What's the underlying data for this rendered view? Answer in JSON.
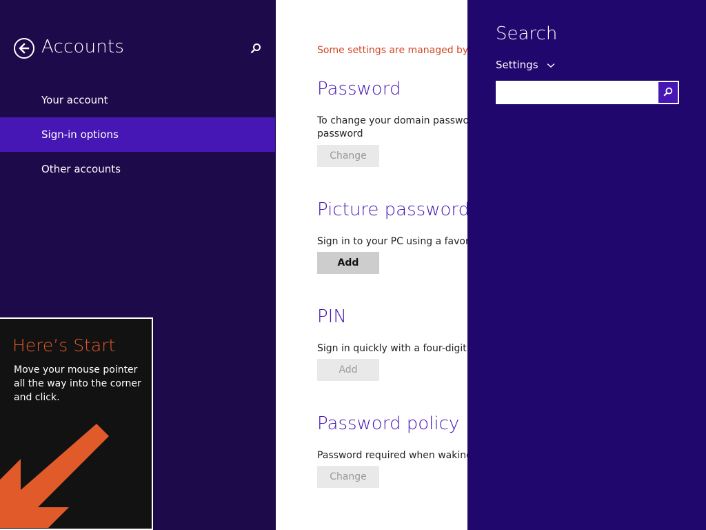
{
  "nav": {
    "title": "Accounts",
    "items": [
      {
        "label": "Your account",
        "selected": false
      },
      {
        "label": "Sign-in options",
        "selected": true
      },
      {
        "label": "Other accounts",
        "selected": false
      }
    ]
  },
  "tip": {
    "title": "Here’s Start",
    "body": "Move your mouse pointer all the way into the corner and click."
  },
  "content": {
    "managed_notice": "Some settings are managed by yo",
    "sections": [
      {
        "title": "Password",
        "description": "To change your domain password,",
        "description2": "password",
        "button": "Change",
        "button_enabled": false
      },
      {
        "title": "Picture password",
        "description": "Sign in to your PC using a favorite",
        "button": "Add",
        "button_enabled": true
      },
      {
        "title": "PIN",
        "description": "Sign in quickly with a four-digit nur",
        "button": "Add",
        "button_enabled": false
      },
      {
        "title": "Password policy",
        "description": "Password required when waking th",
        "button": "Change",
        "button_enabled": false
      }
    ]
  },
  "charm": {
    "title": "Search",
    "scope": "Settings",
    "search_value": ""
  },
  "colors": {
    "nav_bg": "#1c0a4a",
    "nav_selected": "#4617b4",
    "charm_bg": "#20076e",
    "accent": "#4617b4",
    "warning": "#d24726",
    "tip_title": "#e05a2a"
  },
  "icons": [
    "back-arrow-icon",
    "search-icon",
    "chevron-down-icon",
    "corner-arrow-icon"
  ]
}
